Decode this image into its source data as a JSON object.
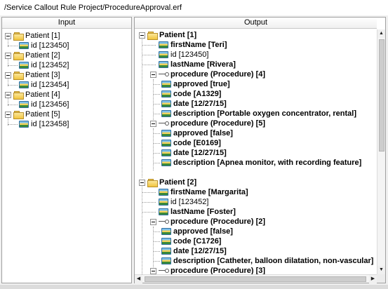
{
  "path": "/Service Callout Rule Project/ProcedureApproval.erf",
  "input": {
    "header": "Input",
    "rows": [
      "Patient [1]",
      "id [123450]",
      "Patient [2]",
      "id [123452]",
      "Patient [3]",
      "id [123454]",
      "Patient [4]",
      "id [123456]",
      "Patient [5]",
      "id [123458]"
    ]
  },
  "output": {
    "header": "Output",
    "rows": [
      "Patient [1]",
      "firstName [Teri]",
      "id [123450]",
      "lastName [Rivera]",
      "procedure (Procedure) [4]",
      "approved [true]",
      "code [A1329]",
      "date [12/27/15]",
      "description [Portable oxygen concentrator, rental]",
      "procedure (Procedure) [5]",
      "approved [false]",
      "code [E0169]",
      "date [12/27/15]",
      "description [Apnea monitor, with recording feature]",
      "Patient [2]",
      "firstName [Margarita]",
      "id [123452]",
      "lastName [Foster]",
      "procedure (Procedure) [2]",
      "approved [false]",
      "code [C1726]",
      "date [12/27/15]",
      "description [Catheter, balloon dilatation, non-vascular]",
      "procedure (Procedure) [3]"
    ]
  },
  "icons": {
    "patient": "folder-icon",
    "field": "field-icon",
    "procedure": "tree-node-icon",
    "expander": "minus-icon"
  },
  "colors": {
    "border": "#a0a0a0",
    "background": "#ffffff"
  }
}
